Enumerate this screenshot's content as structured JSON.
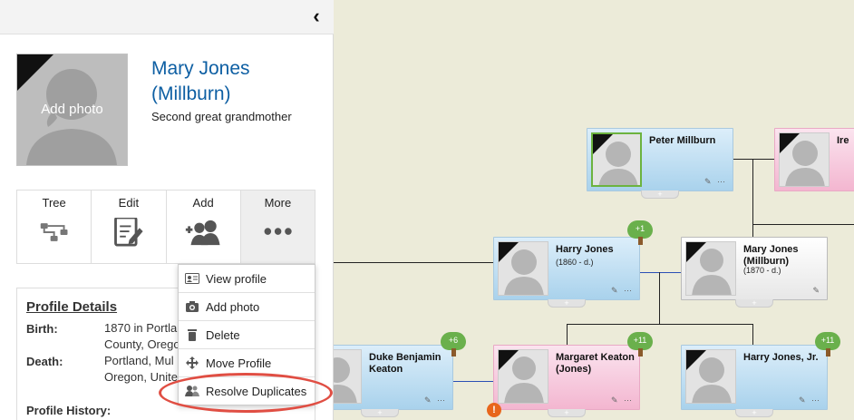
{
  "panel": {
    "collapse_icon": "chevron-left",
    "photo_label": "Add photo",
    "name": "Mary Jones (Millburn)",
    "relationship": "Second great grandmother",
    "actions": [
      {
        "label": "Tree",
        "icon": "tree-icon"
      },
      {
        "label": "Edit",
        "icon": "edit-icon"
      },
      {
        "label": "Add",
        "icon": "add-person-icon"
      },
      {
        "label": "More",
        "icon": "more-icon"
      }
    ],
    "details": {
      "heading": "Profile Details",
      "birth_label": "Birth:",
      "birth_value_1": "1870 in Portla",
      "birth_value_2": "County, Orego",
      "death_label": "Death:",
      "death_value_1": "Portland, Mul",
      "death_value_2": "Oregon, Unite",
      "history_label": "Profile History:"
    }
  },
  "menu": {
    "items": [
      {
        "label": "View profile",
        "icon": "id-card-icon"
      },
      {
        "label": "Add photo",
        "icon": "camera-icon"
      },
      {
        "label": "Delete",
        "icon": "trash-icon"
      },
      {
        "label": "Move Profile",
        "icon": "move-icon"
      },
      {
        "label": "Resolve Duplicates",
        "icon": "users-icon"
      }
    ]
  },
  "tree": {
    "cards": [
      {
        "id": "peter",
        "name": "Peter Millburn",
        "dates": "",
        "gender": "male"
      },
      {
        "id": "ire",
        "name": "Ire",
        "dates": "",
        "gender": "female"
      },
      {
        "id": "harry",
        "name": "Harry Jones",
        "dates": "(1860 -  d.)",
        "gender": "male",
        "badge": "+1"
      },
      {
        "id": "mary",
        "name": "Mary Jones (Millburn)",
        "dates": "(1870 -  d.)",
        "gender": "neutral"
      },
      {
        "id": "duke",
        "name": "Duke Benjamin Keaton",
        "dates": "",
        "gender": "male",
        "badge": "+6"
      },
      {
        "id": "margaret",
        "name": "Margaret Keaton (Jones)",
        "dates": "",
        "gender": "female",
        "badge": "+11",
        "warning": "!"
      },
      {
        "id": "harryjr",
        "name": "Harry Jones, Jr.",
        "dates": "",
        "gender": "male",
        "badge": "+11"
      }
    ],
    "tab_plus": "+",
    "tools_glyph": "✎ ⋯"
  },
  "colors": {
    "accent_name": "#0e5fa3",
    "highlight_ring": "#e04e43",
    "male_card": "#a9d2ec",
    "female_card": "#f3b6d0",
    "tree_badge": "#6ab04c",
    "warning": "#e8661c",
    "canvas_bg": "#ecebd9"
  }
}
